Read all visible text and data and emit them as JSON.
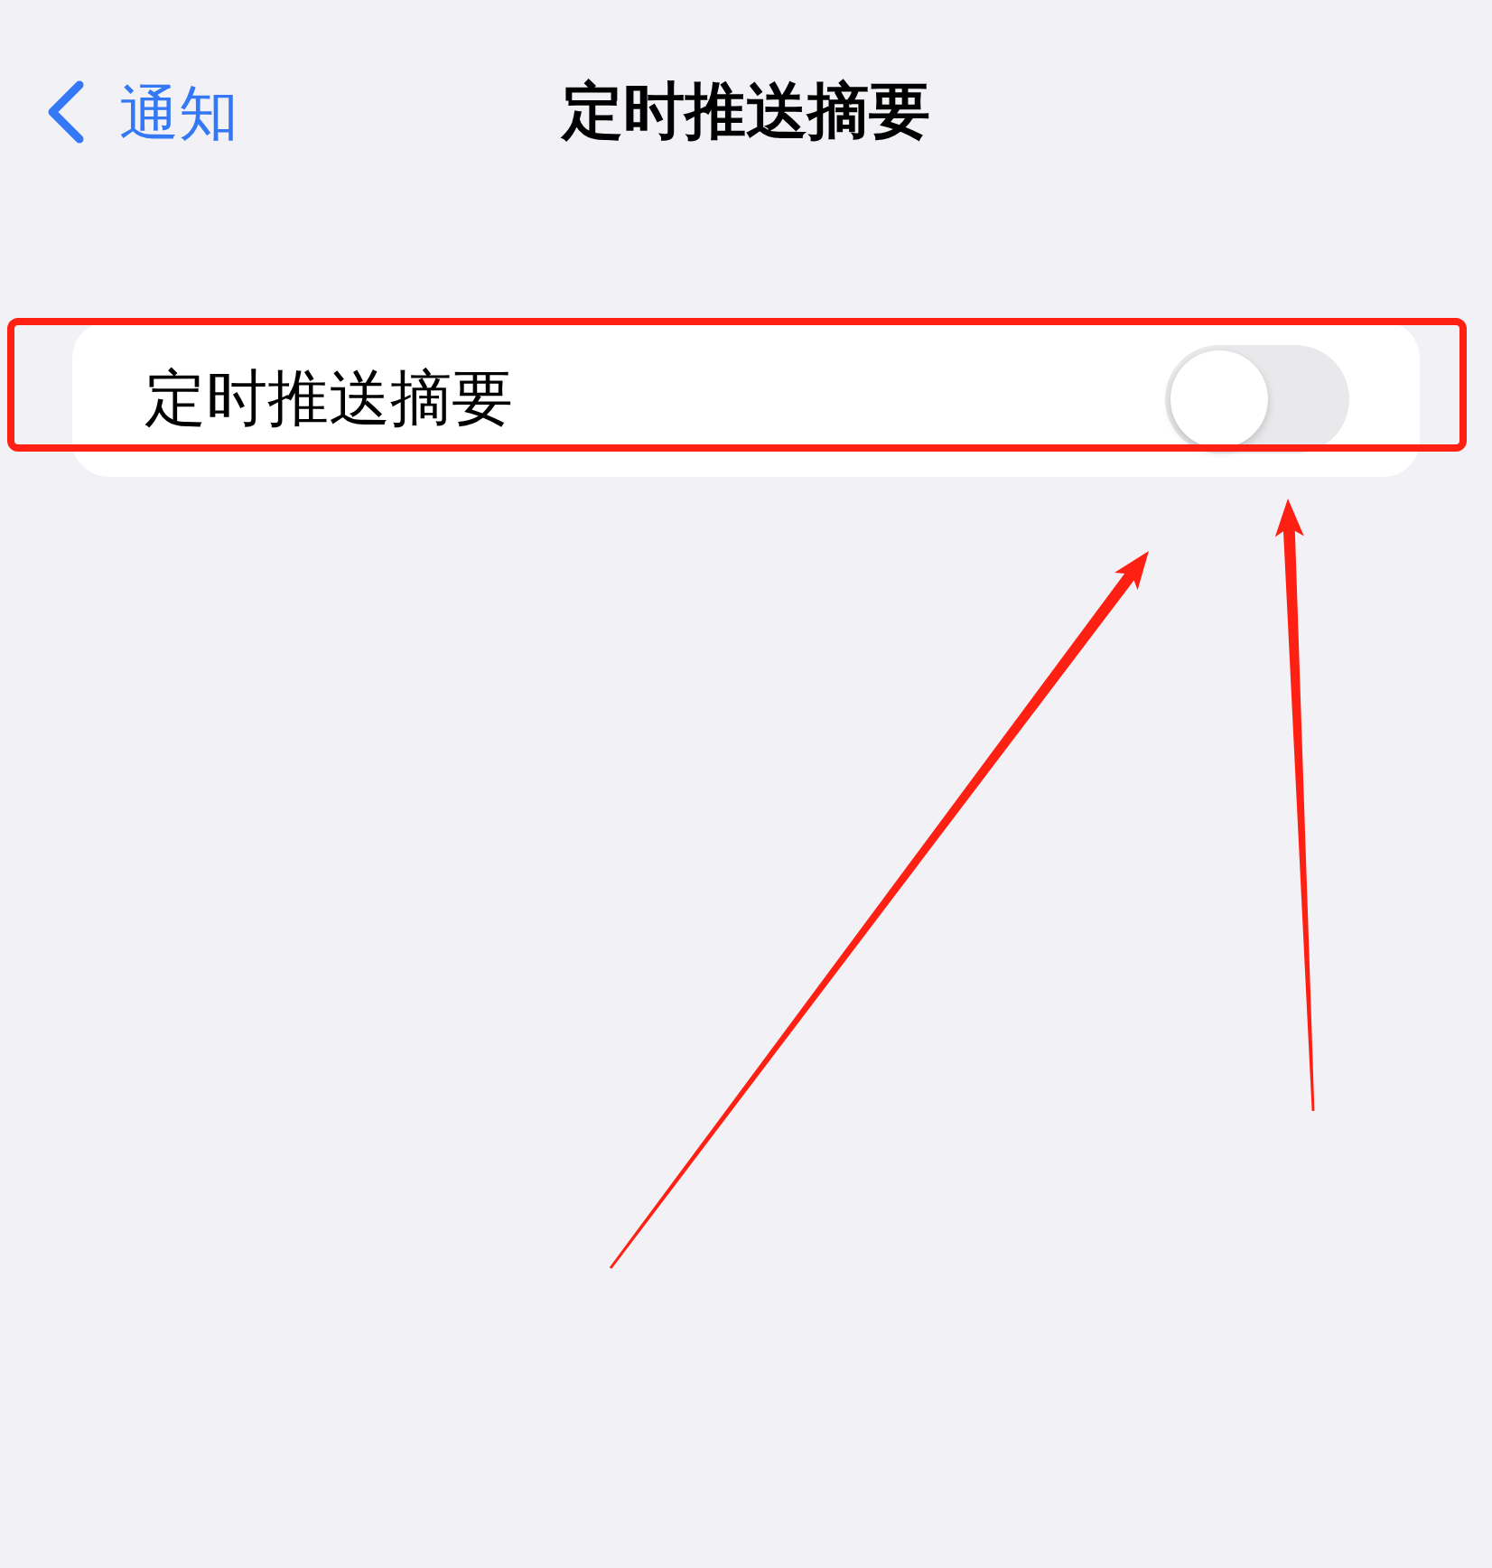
{
  "nav_bar": {
    "back_label": "通知",
    "title": "定时推送摘要"
  },
  "settings_group": {
    "rows": [
      {
        "kind": "toggle",
        "label": "定时推送摘要",
        "on": false
      }
    ]
  },
  "annotations": [
    {
      "kind": "highlight_box"
    },
    {
      "kind": "arrow"
    },
    {
      "kind": "arrow"
    }
  ]
}
